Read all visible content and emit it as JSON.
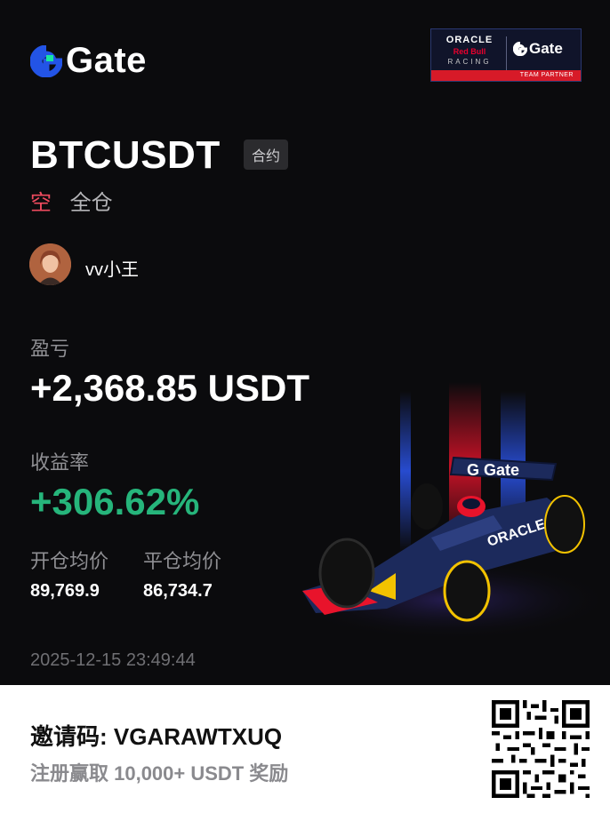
{
  "brand": {
    "logo_text": "Gate"
  },
  "partner_badge": {
    "oracle": "ORACLE",
    "red_bull": "Red Bull",
    "racing": "RACING",
    "gate": "Gate",
    "band": "TEAM PARTNER"
  },
  "position": {
    "pair": "BTCUSDT",
    "contract_type": "合约",
    "side": "空",
    "margin_mode": "全仓"
  },
  "user": {
    "name": "vv小王"
  },
  "stats": {
    "pnl_label": "盈亏",
    "pnl_value": "+2,368.85 USDT",
    "roi_label": "收益率",
    "roi_value": "+306.62%",
    "open_price_label": "开仓均价",
    "open_price_value": "89,769.9",
    "close_price_label": "平仓均价",
    "close_price_value": "86,734.7"
  },
  "timestamp": "2025-12-15 23:49:44",
  "footer": {
    "invite_code": "邀请码: VGARAWTXUQ",
    "reward_text": "注册赢取 10,000+ USDT 奖励"
  },
  "colors": {
    "background": "#0b0b0d",
    "short": "#f04b5f",
    "profit": "#26b57b",
    "gate_blue": "#2354e6",
    "gate_green": "#17e6a1"
  }
}
